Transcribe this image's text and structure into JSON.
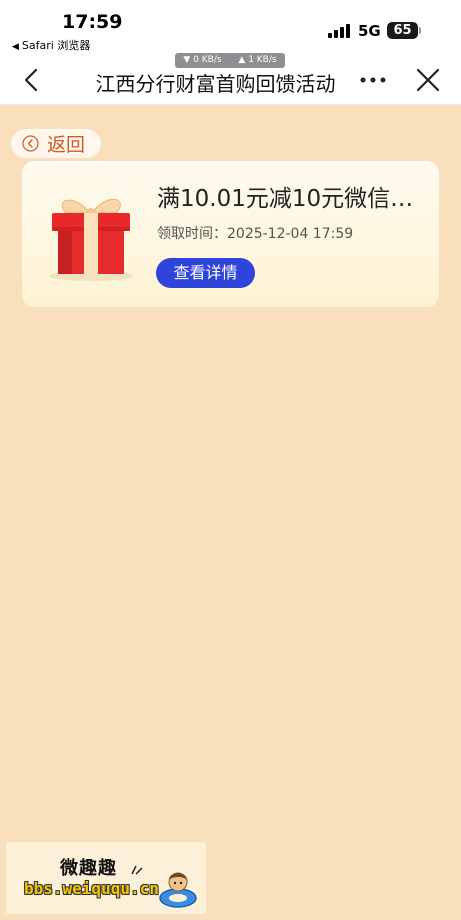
{
  "status_bar": {
    "time": "17:59",
    "back_app": "Safari 浏览器",
    "network": "5G",
    "battery": "65",
    "speed_down": "▼ 0 KB/s",
    "speed_up": "▲ 1 KB/s"
  },
  "nav": {
    "title": "江西分行财富首购回馈活动",
    "back_icon": "chevron-left-icon",
    "more_icon": "more-dots-icon",
    "close_icon": "close-icon"
  },
  "return_button": {
    "label": "返回",
    "icon": "circle-chevron-left-icon"
  },
  "coupon_card": {
    "title": "满10.01元减10元微信…",
    "claim_time": "领取时间：2025-12-04 17:59",
    "detail_button": "查看详情",
    "icon": "gift-box-icon"
  },
  "watermark": {
    "title": "微趣趣",
    "url": "bbs.weiququ.cn"
  },
  "colors": {
    "page_bg": "#f9dfbb",
    "button_blue": "#2f44d8",
    "return_text": "#d2582c"
  }
}
